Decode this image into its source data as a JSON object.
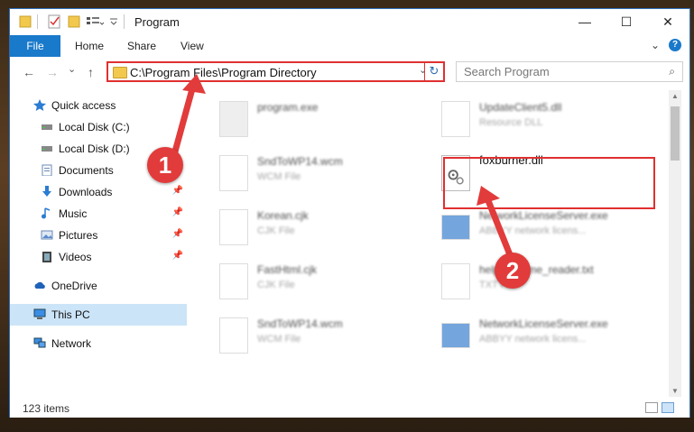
{
  "window": {
    "title": "Program",
    "controls": {
      "minimize": "—",
      "maximize": "☐",
      "close": "✕"
    }
  },
  "ribbon": {
    "tabs": [
      "File",
      "Home",
      "Share",
      "View"
    ],
    "expand_icon": "chevron-down-icon",
    "help": "?"
  },
  "nav": {
    "back": "←",
    "forward": "→",
    "recent": "⌄",
    "up": "↑",
    "address": "C:\\Program Files\\Program Directory",
    "refresh": "↻",
    "search_placeholder": "Search Program",
    "search_icon": "⌕"
  },
  "sidebar": {
    "items": [
      {
        "label": "Quick access",
        "icon": "star-icon",
        "pin": ""
      },
      {
        "label": "Local Disk (C:)",
        "icon": "drive-icon",
        "pin": ""
      },
      {
        "label": "Local Disk (D:)",
        "icon": "drive-icon",
        "pin": ""
      },
      {
        "label": "Documents",
        "icon": "documents-icon",
        "pin": ""
      },
      {
        "label": "Downloads",
        "icon": "downloads-icon",
        "pin": "📌"
      },
      {
        "label": "Music",
        "icon": "music-icon",
        "pin": "📌"
      },
      {
        "label": "Pictures",
        "icon": "pictures-icon",
        "pin": "📌"
      },
      {
        "label": "Videos",
        "icon": "videos-icon",
        "pin": "📌"
      },
      {
        "label": "OneDrive",
        "icon": "cloud-icon",
        "pin": ""
      },
      {
        "label": "This PC",
        "icon": "computer-icon",
        "pin": ""
      },
      {
        "label": "Network",
        "icon": "network-icon",
        "pin": ""
      }
    ]
  },
  "files": [
    {
      "name": "program.exe",
      "type": ""
    },
    {
      "name": "UpdateClient5.dll",
      "type": "Resource DLL"
    },
    {
      "name": "SndToWP14.wcm",
      "type": "WCM File"
    },
    {
      "name": "foxburner.dll",
      "type": ""
    },
    {
      "name": "Korean.cjk",
      "type": "CJK File"
    },
    {
      "name": "NetworkLicenseServer.exe",
      "type": "ABBYY network licens..."
    },
    {
      "name": "FastHtml.cjk",
      "type": "CJK File"
    },
    {
      "name": "help_readme_reader.txt",
      "type": "TXT File"
    },
    {
      "name": "SndToWP14.wcm",
      "type": "WCM File"
    },
    {
      "name": "NetworkLicenseServer.exe",
      "type": "ABBYY network licens..."
    }
  ],
  "status": {
    "count": "123 items"
  },
  "callouts": {
    "one": "1",
    "two": "2"
  },
  "colors": {
    "accent": "#1979ca",
    "highlight": "#e03030",
    "callout": "#e23b3b"
  }
}
